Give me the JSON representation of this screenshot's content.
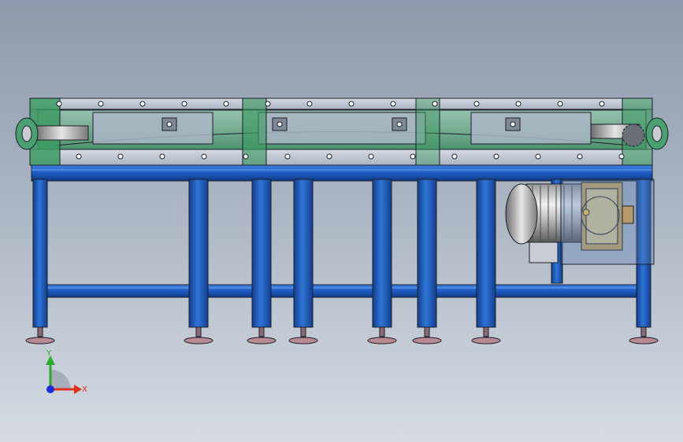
{
  "model": {
    "name": "conveyor-assembly",
    "view": "front",
    "colors": {
      "frame_blue": "#1e5fc7",
      "frame_blue_dark": "#123f8c",
      "frame_blue_light": "#4a86e0",
      "belt_green": "#2f8a55",
      "belt_green_light": "#5cb27a",
      "steel": "#c9ccd3",
      "steel_dark": "#6b6f78",
      "foot_pink": "#b88a93",
      "motor_silver": "#d8d8d8",
      "gearbox_gold": "#c9a862",
      "edge": "#1b1f29"
    }
  },
  "triad": {
    "x_label": "X",
    "y_label": "Y",
    "x_color": "#e0301e",
    "y_color": "#2ea82e",
    "z_color": "#1a2bd6"
  }
}
